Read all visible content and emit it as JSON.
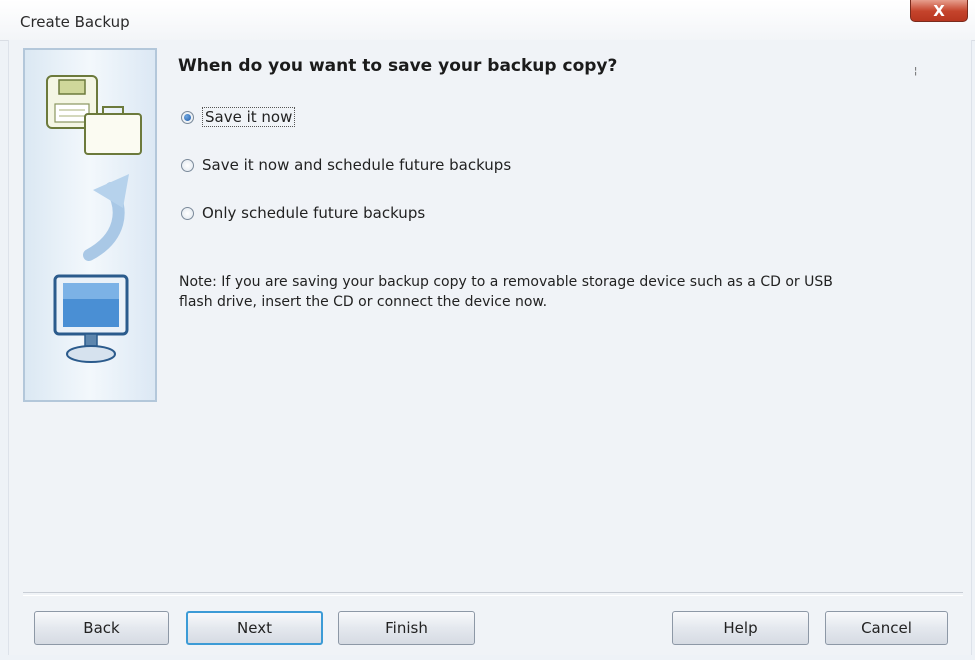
{
  "window": {
    "title": "Create Backup",
    "close_glyph": "X"
  },
  "main": {
    "heading": "When do you want to save your backup copy?",
    "side_mark": "¦",
    "options": [
      {
        "label": "Save it now",
        "checked": true
      },
      {
        "label": "Save it now and schedule future backups",
        "checked": false
      },
      {
        "label": "Only schedule future backups",
        "checked": false
      }
    ],
    "note": "Note: If you are saving your backup copy to a removable storage device such as a CD or USB flash drive, insert the CD or connect the device now."
  },
  "buttons": {
    "back": "Back",
    "next": "Next",
    "finish": "Finish",
    "help": "Help",
    "cancel": "Cancel"
  },
  "icons": [
    "floppy-disk-icon",
    "briefcase-icon",
    "curved-arrow-icon",
    "monitor-icon"
  ],
  "colors": {
    "default_button_border": "#3c9bd6",
    "close_button": "#c5442c",
    "radio_selected": "#1f5aa8"
  }
}
